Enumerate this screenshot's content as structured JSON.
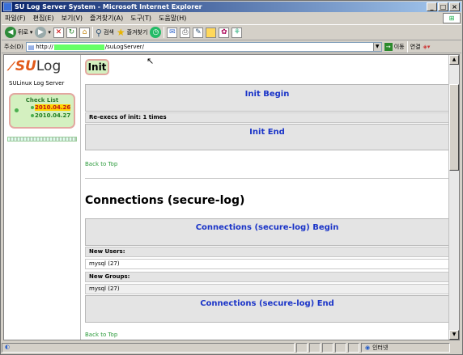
{
  "window": {
    "title": "SU Log Server System - Microsoft Internet Explorer",
    "controls": [
      "_",
      "□",
      "×"
    ]
  },
  "menu": [
    "파일(F)",
    "편집(E)",
    "보기(V)",
    "즐겨찾기(A)",
    "도구(T)",
    "도움말(H)"
  ],
  "toolbar": {
    "back_label": "뒤로",
    "search_label": "검색",
    "favorites_label": "즐겨찾기"
  },
  "address": {
    "label": "주소(D)",
    "url_prefix": "http://",
    "url_suffix": "/suLogServer/",
    "go_label": "이동",
    "links_label": "연결"
  },
  "sidebar": {
    "logo_su": "SU",
    "logo_log": "Log",
    "subtitle": "SULinux Log Server",
    "checklist_title": "Check List",
    "dates": [
      "2010.04.26",
      "2010.04.27"
    ]
  },
  "main": {
    "init_badge": "Init",
    "init_begin": "Init Begin",
    "reexec": "Re-execs of init: 1 times",
    "init_end": "Init End",
    "back_to_top_1": "Back to Top",
    "connections_heading": "Connections (secure-log)",
    "conn_begin": "Connections (secure-log) Begin",
    "new_users_label": "New Users:",
    "new_users_value": "mysql (27)",
    "new_groups_label": "New Groups:",
    "new_groups_value": "mysql (27)",
    "conn_end": "Connections (secure-log) End",
    "back_to_top_2": "Back to Top"
  },
  "status": {
    "zone": "인터넷"
  }
}
